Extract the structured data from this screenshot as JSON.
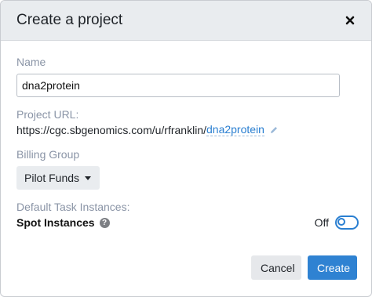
{
  "dialog": {
    "title": "Create a project",
    "close_icon": "close-icon"
  },
  "form": {
    "name_label": "Name",
    "name_value": "dna2protein",
    "url_label": "Project URL:",
    "url_base": "https://cgc.sbgenomics.com/u/rfranklin/",
    "url_slug": "dna2protein",
    "edit_icon": "pencil-icon",
    "billing_label": "Billing Group",
    "billing_value": "Pilot Funds",
    "task_label": "Default Task Instances:",
    "spot_label": "Spot Instances",
    "help_icon_glyph": "?",
    "spot_state": "Off",
    "spot_enabled": false
  },
  "footer": {
    "cancel_label": "Cancel",
    "create_label": "Create"
  },
  "colors": {
    "accent": "#2f82d2",
    "header_bg": "#e9ecef",
    "label": "#8a94a6"
  }
}
